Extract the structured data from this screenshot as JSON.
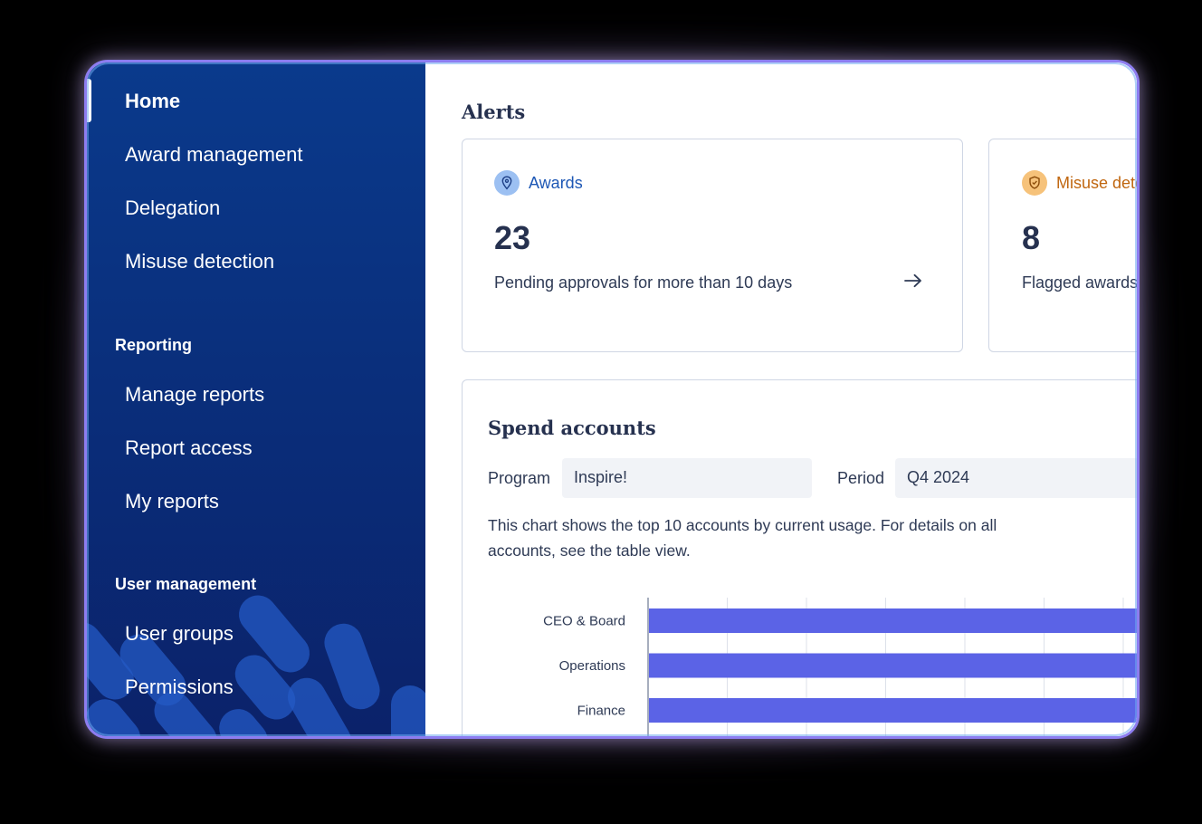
{
  "sidebar": {
    "items": [
      {
        "label": "Home"
      },
      {
        "label": "Award management"
      },
      {
        "label": "Delegation"
      },
      {
        "label": "Misuse detection"
      }
    ],
    "reporting": {
      "heading": "Reporting",
      "items": [
        {
          "label": "Manage reports"
        },
        {
          "label": "Report access"
        },
        {
          "label": "My reports"
        }
      ]
    },
    "user_management": {
      "heading": "User management",
      "items": [
        {
          "label": "User groups"
        },
        {
          "label": "Permissions"
        }
      ]
    }
  },
  "main": {
    "alerts_title": "Alerts",
    "alerts": [
      {
        "label": "Awards",
        "count": "23",
        "description": "Pending approvals for more than 10 days",
        "icon": "location-pin-icon",
        "color": "#1d57b5",
        "badge_color": "#9cc0f2"
      },
      {
        "label": "Misuse dete",
        "count": "8",
        "description": "Flagged awards",
        "icon": "shield-icon",
        "color": "#c0660f",
        "badge_color": "#f6c27a"
      }
    ],
    "spend": {
      "title": "Spend accounts",
      "program_label": "Program",
      "program_value": "Inspire!",
      "period_label": "Period",
      "period_value": "Q4 2024",
      "description": "This chart shows the top 10 accounts by current usage. For details on all accounts, see the table view."
    }
  },
  "colors": {
    "sidebar": "#0a2f7c",
    "bar": "#5b63e6",
    "accent_border": "#8d7df0"
  },
  "chart_data": {
    "type": "bar",
    "orientation": "horizontal",
    "categories": [
      "CEO & Board",
      "Operations",
      "Finance"
    ],
    "series": [
      {
        "values": [
          100,
          100,
          100
        ]
      }
    ],
    "grid": true,
    "note": "bars extend beyond visible area"
  }
}
